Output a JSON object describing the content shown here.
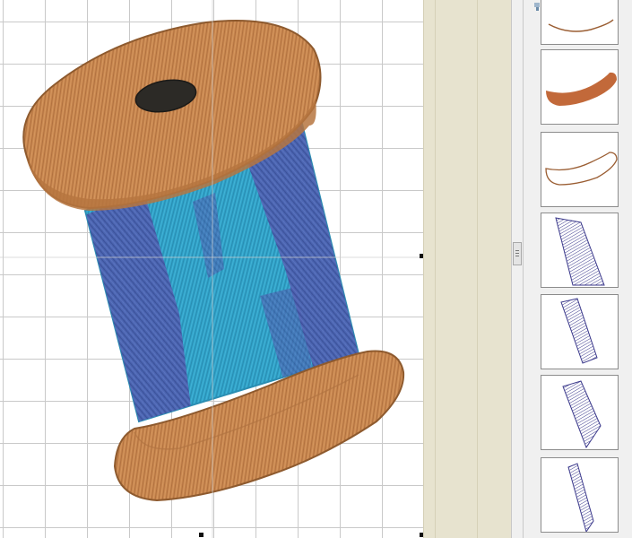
{
  "canvas": {
    "design": "thread-spool-embroidery",
    "colors": {
      "spool_wood": "#c8874f",
      "spool_wood_dark": "#8e5a2e",
      "thread_light": "#2fa2c8",
      "thread_dark": "#5a5aa8",
      "spool_hole": "#2c2a26"
    }
  },
  "object_panel": {
    "toolbar_icons": [
      "sort-icon",
      "list-icon"
    ],
    "items": [
      {
        "name": "top-rim-outline",
        "color": "#9a5d32",
        "style": "outline"
      },
      {
        "name": "bottom-rim-fill",
        "color": "#c2693a",
        "style": "fill"
      },
      {
        "name": "bottom-rim-outline",
        "color": "#9a5d32",
        "style": "outline"
      },
      {
        "name": "thread-stripe-1",
        "color": "#3c3a8c",
        "style": "fill"
      },
      {
        "name": "thread-stripe-2",
        "color": "#3c3a8c",
        "style": "fill"
      },
      {
        "name": "thread-stripe-3",
        "color": "#3c3a8c",
        "style": "fill"
      },
      {
        "name": "thread-stripe-4",
        "color": "#3c3a8c",
        "style": "fill"
      }
    ]
  }
}
